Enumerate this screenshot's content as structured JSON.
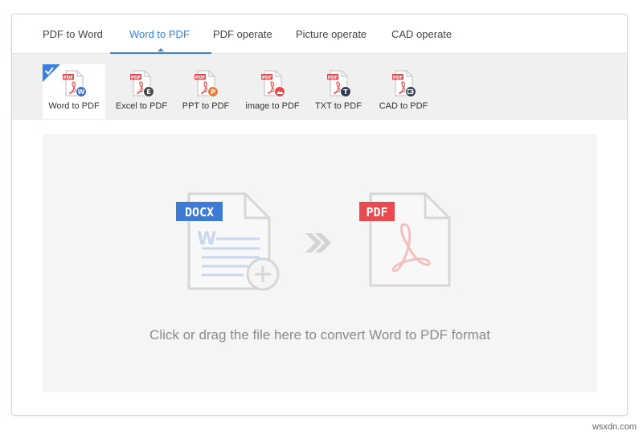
{
  "tabs": [
    {
      "label": "PDF to Word",
      "active": false
    },
    {
      "label": "Word to PDF",
      "active": true
    },
    {
      "label": "PDF operate",
      "active": false
    },
    {
      "label": "Picture operate",
      "active": false
    },
    {
      "label": "CAD operate",
      "active": false
    }
  ],
  "tools": [
    {
      "label": "Word to PDF",
      "badge_icon": "w-icon",
      "badge_color": "#3e6fd0",
      "active": true
    },
    {
      "label": "Excel to PDF",
      "badge_icon": "e-icon",
      "badge_color": "#4a4a4a",
      "active": false
    },
    {
      "label": "PPT to PDF",
      "badge_icon": "p-icon",
      "badge_color": "#ec7a3b",
      "active": false
    },
    {
      "label": "image to PDF",
      "badge_icon": "image-icon",
      "badge_color": "#e9474a",
      "active": false
    },
    {
      "label": "TXT to PDF",
      "badge_icon": "t-icon",
      "badge_color": "#2f3e55",
      "active": false
    },
    {
      "label": "CAD to PDF",
      "badge_icon": "cad-icon",
      "badge_color": "#2f3e55",
      "active": false
    }
  ],
  "file_tag": "PDF",
  "dropzone": {
    "source_tag": "DOCX",
    "target_tag": "PDF",
    "instruction": "Click or drag the file here to convert Word to PDF format"
  },
  "colors": {
    "accent": "#3b7fe0",
    "docx_tag": "#3e7bd6",
    "pdf_tag": "#ea4a4e",
    "pdf_red": "#e53c3c"
  },
  "watermark": "wsxdn.com"
}
